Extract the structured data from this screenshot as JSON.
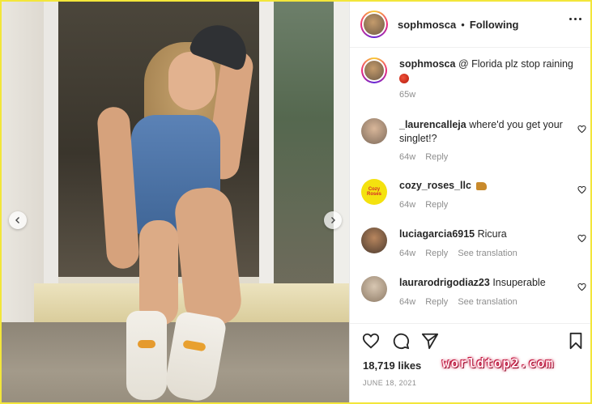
{
  "post": {
    "username": "sophmosca",
    "separator": "•",
    "follow_status": "Following"
  },
  "caption": {
    "username": "sophmosca",
    "text": "@ Florida plz stop raining",
    "emoji": "basketball-emoji",
    "time": "65w"
  },
  "comments": [
    {
      "username": "_laurencalleja",
      "text": "where'd you get your singlet!?",
      "time": "64w",
      "reply": "Reply",
      "translate": ""
    },
    {
      "username": "cozy_roses_llc",
      "text": "",
      "emoji": "boot-emoji",
      "time": "64w",
      "reply": "Reply",
      "translate": "",
      "avatar_text": "Cozy\nRoses"
    },
    {
      "username": "luciagarcia6915",
      "text": "Ricura",
      "time": "64w",
      "reply": "Reply",
      "translate": "See translation"
    },
    {
      "username": "laurarodrigodiaz23",
      "text": "Insuperable",
      "time": "64w",
      "reply": "Reply",
      "translate": "See translation"
    }
  ],
  "engagement": {
    "likes": "18,719 likes",
    "date": "JUNE 18, 2021"
  },
  "watermark": "worldtop2.com",
  "icons": {
    "more": "more-options-icon",
    "like": "heart-icon",
    "comment": "comment-icon",
    "share": "send-icon",
    "save": "bookmark-icon",
    "prev": "chevron-left-icon",
    "next": "chevron-right-icon"
  },
  "colors": {
    "frame": "#f3e63a",
    "text": "#262626",
    "muted": "#8e8e8e"
  }
}
